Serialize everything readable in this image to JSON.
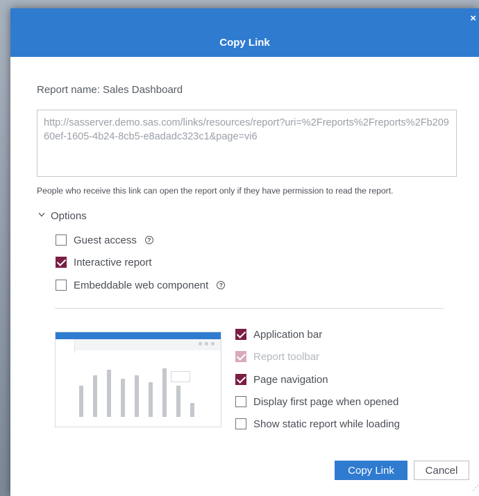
{
  "dialog": {
    "title": "Copy Link",
    "close_glyph": "×",
    "report_name_label": "Report name: Sales Dashboard",
    "link_url": "http://sasserver.demo.sas.com/links/resources/report?uri=%2Freports%2Freports%2Fb20960ef-1605-4b24-8cb5-e8adadc323c1&page=vi6",
    "permission_note": "People who receive this link can open the report only if they have permission to read the report.",
    "options": {
      "label": "Options",
      "expanded": true,
      "toggle_icon": "chevron-down-icon",
      "items": [
        {
          "label": "Guest access",
          "checked": false,
          "help": true
        },
        {
          "label": "Interactive report",
          "checked": true,
          "help": false
        },
        {
          "label": "Embeddable web component",
          "checked": false,
          "help": true
        }
      ],
      "help_glyph": "?"
    },
    "interactive_options": [
      {
        "label": "Application bar",
        "checked": true,
        "disabled": false
      },
      {
        "label": "Report toolbar",
        "checked": true,
        "disabled": true
      },
      {
        "label": "Page navigation",
        "checked": true,
        "disabled": false
      },
      {
        "label": "Display first page when opened",
        "checked": false,
        "disabled": false
      },
      {
        "label": "Show static report while loading",
        "checked": false,
        "disabled": false
      }
    ],
    "preview": {
      "bar_levels": [
        0.45,
        0.6,
        0.68,
        0.55,
        0.6,
        0.5,
        0.7,
        0.45,
        0.2
      ]
    },
    "buttons": {
      "primary": "Copy Link",
      "secondary": "Cancel"
    }
  },
  "colors": {
    "header_blue": "#2f7bd0",
    "checkbox_checked": "#7a1e45",
    "checkbox_disabled": "#d9a9bd"
  }
}
